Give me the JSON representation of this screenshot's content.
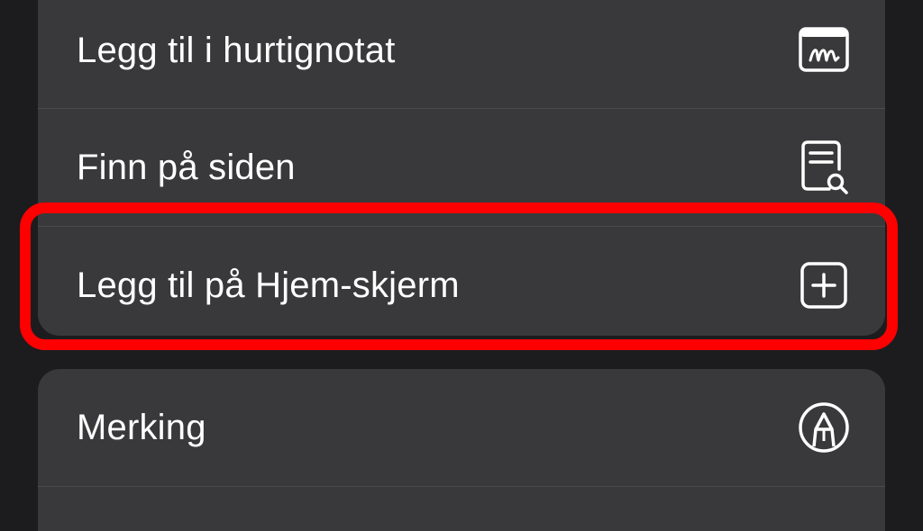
{
  "menu": {
    "items": [
      {
        "label": "Legg til i hurtignotat",
        "icon": "quick-note-icon"
      },
      {
        "label": "Finn på siden",
        "icon": "find-on-page-icon"
      },
      {
        "label": "Legg til på Hjem-skjerm",
        "icon": "add-square-icon"
      }
    ],
    "secondary_items": [
      {
        "label": "Merking",
        "icon": "markup-pen-icon"
      }
    ]
  },
  "highlight": {
    "color": "#ff0000",
    "target": "Legg til på Hjem-skjerm"
  },
  "colors": {
    "background": "#1c1c1e",
    "row_background": "#39393b",
    "separator": "#4a4a4d",
    "text": "#ffffff"
  }
}
